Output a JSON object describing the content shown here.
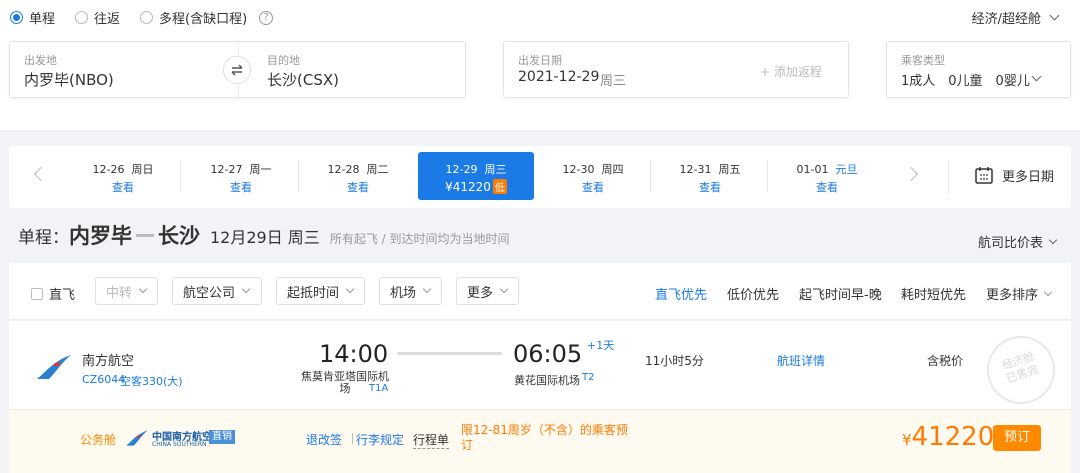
{
  "trip_types": [
    {
      "label": "单程",
      "selected": true
    },
    {
      "label": "往返",
      "selected": false
    },
    {
      "label": "多程(含缺口程)",
      "selected": false
    }
  ],
  "cabin_class": "经济/超经舱",
  "search": {
    "from_label": "出发地",
    "from_value": "内罗毕(NBO)",
    "to_label": "目的地",
    "to_value": "长沙(CSX)",
    "date_label": "出发日期",
    "date_value": "2021-12-29",
    "date_weekday": "周三",
    "add_return": "+ 添加返程",
    "passenger_label": "乘客类型",
    "passenger_value": "1成人　0儿童　0婴儿"
  },
  "date_strip": {
    "dates": [
      {
        "date": "12-26",
        "weekday": "周日",
        "sub": "查看"
      },
      {
        "date": "12-27",
        "weekday": "周一",
        "sub": "查看"
      },
      {
        "date": "12-28",
        "weekday": "周二",
        "sub": "查看"
      },
      {
        "date": "12-29",
        "weekday": "周三",
        "sub": "¥41220",
        "badge": "低"
      },
      {
        "date": "12-30",
        "weekday": "周四",
        "sub": "查看"
      },
      {
        "date": "12-31",
        "weekday": "周五",
        "sub": "查看"
      },
      {
        "date": "01-01",
        "weekday": "元旦",
        "sub": "查看"
      }
    ],
    "more_dates": "更多日期"
  },
  "route": {
    "prefix": "单程：",
    "from": "内罗毕",
    "to": "长沙",
    "date": "12月29日 周三",
    "note": "所有起飞 / 到达时间均为当地时间",
    "compare": "航司比价表"
  },
  "filters": {
    "direct": "直飞",
    "transfer": "中转",
    "airline": "航空公司",
    "times": "起抵时间",
    "airport": "机场",
    "more": "更多"
  },
  "sorts": [
    "直飞优先",
    "低价优先",
    "起飞时间早-晚",
    "耗时短优先",
    "更多排序"
  ],
  "flight": {
    "airline": "南方航空",
    "flight_no": "CZ6044",
    "aircraft": "空客330(大)",
    "dep_time": "14:00",
    "dep_airport": "焦莫肯亚塔国际机场",
    "dep_terminal": "T1A",
    "arr_time": "06:05",
    "day_offset": "+1天",
    "arr_airport": "黄花国际机场",
    "arr_terminal": "T2",
    "duration": "11小时5分",
    "details": "航班详情",
    "tax_note": "含税价",
    "stamp_line1": "经济舱",
    "stamp_line2": "已售完",
    "cabin": "公务舱",
    "brand_cn": "中国南方航空",
    "brand_en": "CHINA SOUTHERN",
    "direct_sale": "直销",
    "refund": "退改签",
    "baggage": "行李规定",
    "itinerary": "行程单",
    "restriction": "限12-81周岁（不含）的乘客预订",
    "currency": "¥",
    "price": "41220",
    "book": "预订"
  },
  "colors": {
    "accent": "#1a7ae6",
    "price": "#ff7a00",
    "cabin": "#ff8a00"
  }
}
